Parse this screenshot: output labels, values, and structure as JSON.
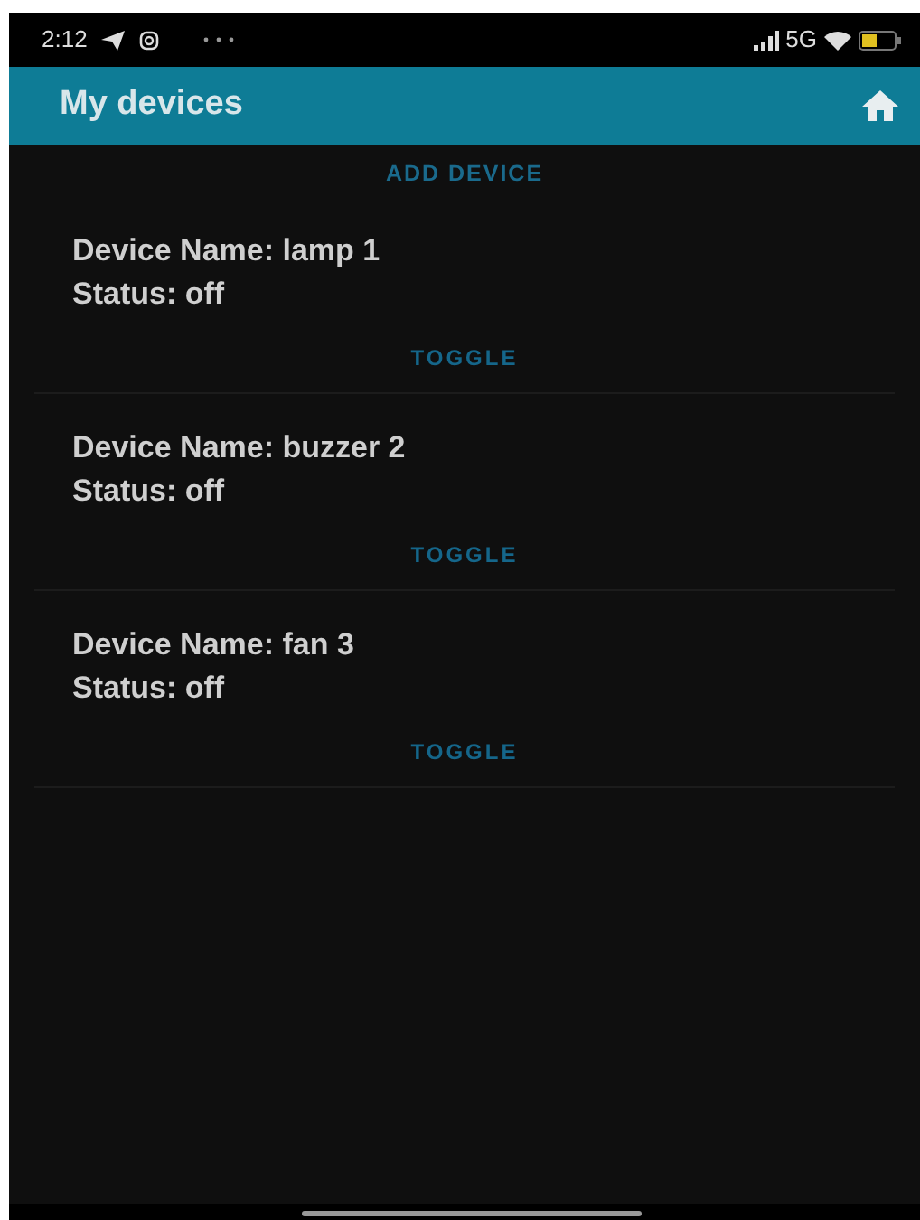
{
  "status_bar": {
    "time": "2:12",
    "network": "5G"
  },
  "app_bar": {
    "title": "My devices"
  },
  "add_button": {
    "label": "ADD DEVICE"
  },
  "devices": [
    {
      "name": "Device Name: lamp 1",
      "status": "Status: off",
      "button": "TOGGLE"
    },
    {
      "name": "Device Name: buzzer 2",
      "status": "Status: off",
      "button": "TOGGLE"
    },
    {
      "name": "Device Name: fan 3",
      "status": "Status: off",
      "button": "TOGGLE"
    }
  ]
}
